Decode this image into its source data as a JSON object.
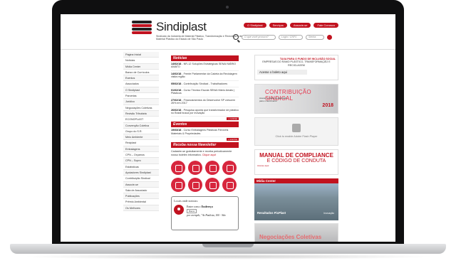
{
  "site": {
    "brand": "Sindiplast",
    "tagline": "Sindicato da Indústria de Material Plástico, Transformação e Reciclagem de Material Plástico do Estado de São Paulo",
    "colors": {
      "accent": "#c1121f"
    }
  },
  "top_nav": [
    "O Sindiplast",
    "Serviços",
    "Associe-se",
    "Fale Conosco"
  ],
  "search": {
    "placeholder": "O que você procura?",
    "login_placeholder": "Login / CNPJ",
    "password_placeholder": "Senha"
  },
  "left_nav": [
    "Página Inicial",
    "Notícias",
    "Mídia Center",
    "Banco de Currículos",
    "Eventos",
    "Associados",
    "O Sindiplast",
    "Parcerias",
    "Jurídico",
    "Negociações Coletivas",
    "Revisão Tributária",
    "ECONOPLAST",
    "Convenção Coletiva",
    "Grupo do S.R.",
    "Meio Ambiente",
    "Reciplast",
    "Embalagens",
    "CPN – Orçamos",
    "CPN – Sopro",
    "Estatísticas",
    "Apoiadores Sindiplast",
    "Contribuição Sindical",
    "Associe-se",
    "Sala de Associado",
    "Publicações",
    "Prêmio Ambiental",
    "Os Melhores"
  ],
  "news": {
    "title": "Notícias",
    "items": [
      {
        "date": "14/02/18",
        "text": "- NR-12 Soluções Estratégicas SENAI MÁRIO AMATO"
      },
      {
        "date": "14/02/18",
        "text": "- Frente Parlamentar da Cadeia da Reciclagem visita região"
      },
      {
        "date": "05/02/18",
        "text": "- Contribuição Sindical - Trabalhadores"
      },
      {
        "date": "01/02/18",
        "text": "- Curso Técnico Escola SENAI Mário Amato | Plásticos"
      },
      {
        "date": "27/02/18",
        "text": "- Financiamentos do Desenvolve SP crescem 26% em 2017"
      },
      {
        "date": "26/02/18",
        "text": "- Pesquisa aponta que transformador de plástico no Brasil busca por inovação"
      }
    ],
    "more": "+ notícias"
  },
  "events": {
    "title": "Eventos",
    "items": [
      {
        "date": "19/03/18",
        "text": "- Curso Embalagens Plásticas Flexíveis Materiais & Propriedades"
      }
    ],
    "more": "+ eventos"
  },
  "newsletter": {
    "title": "Receba nossa Newsletter",
    "text": "Cadastre-se gratuitamente e receba periodicamente nosso boletim informativo.",
    "link": "Clique aqui!"
  },
  "locator": {
    "title": "Locais onde noticias:",
    "line1": "Entre com o",
    "line1b": "Endereço",
    "button": "Buscar",
    "example": "por exemplo, \"Av Paulista, 100 - São"
  },
  "right": {
    "taxa": {
      "title": "TAXA PARA O FUNDO DE INCLUSÃO SOCIAL",
      "sub": "EMPRESAS DO RAMO PLÁSTICO, TRANSFORMAÇÃO E RECICLAGEM",
      "link": "Acesse o boleto aqui"
    },
    "contrib": {
      "title": "CONTRIBUIÇÃO SINDICAL",
      "year": "2018",
      "sub": "Acesse o boleto já agendado para o vencimento"
    },
    "flash": "Click to enable Adobe Flash Player",
    "compliance": {
      "title1": "MANUAL DE COMPLIANCE",
      "title2": "E CÓDIGO DE CONDUTA",
      "link": "Acesse aqui"
    },
    "media": {
      "title": "Mídia Center",
      "caption": "Resultados PicPlast",
      "caption2": "Inovação"
    },
    "banner": "Negociações Coletivas"
  }
}
